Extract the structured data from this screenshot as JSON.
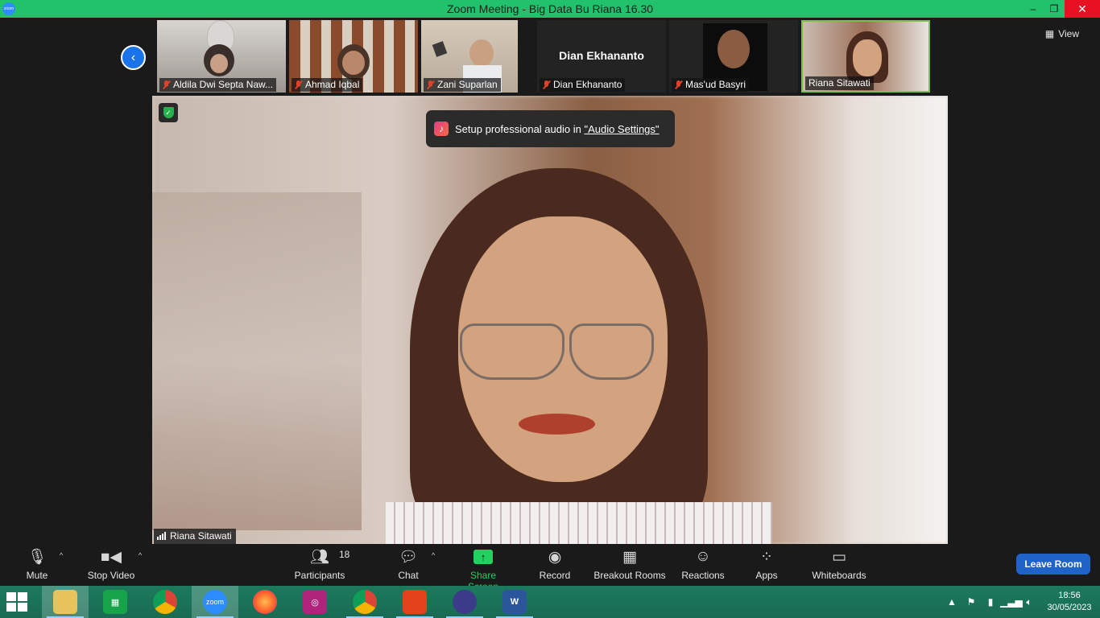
{
  "window": {
    "title": "Zoom Meeting - Big Data    Bu Riana  16.30",
    "app_icon_label": "zoom"
  },
  "view_label": "View",
  "thumbnails": [
    {
      "name": "Aldila Dwi Septa Naw...",
      "muted": true
    },
    {
      "name": "Ahmad Iqbal",
      "muted": true
    },
    {
      "name": "Zani Suparlan",
      "muted": true
    },
    {
      "name": "Dian Ekhananto",
      "muted": true,
      "display_name": "Dian Ekhananto"
    },
    {
      "name": "Mas'ud Basyri",
      "muted": true
    },
    {
      "name": "Riana Sitawati",
      "muted": false,
      "active": true
    }
  ],
  "toast": {
    "text": "Setup professional audio in ",
    "link": "\"Audio Settings\""
  },
  "speaker": {
    "name": "Riana Sitawati"
  },
  "toolbar": {
    "mute": "Mute",
    "stop_video": "Stop Video",
    "participants": "Participants",
    "participants_count": "18",
    "chat": "Chat",
    "share_screen": "Share Screen",
    "record": "Record",
    "breakout_rooms": "Breakout Rooms",
    "reactions": "Reactions",
    "apps": "Apps",
    "whiteboards": "Whiteboards",
    "leave": "Leave Room"
  },
  "taskbar": {
    "zoom_label": "zoom",
    "time": "18:56",
    "date": "30/05/2023"
  },
  "colors": {
    "titlebar": "#21c26b",
    "accent": "#1a73e8",
    "share": "#23d160",
    "leave": "#1f63c9"
  }
}
